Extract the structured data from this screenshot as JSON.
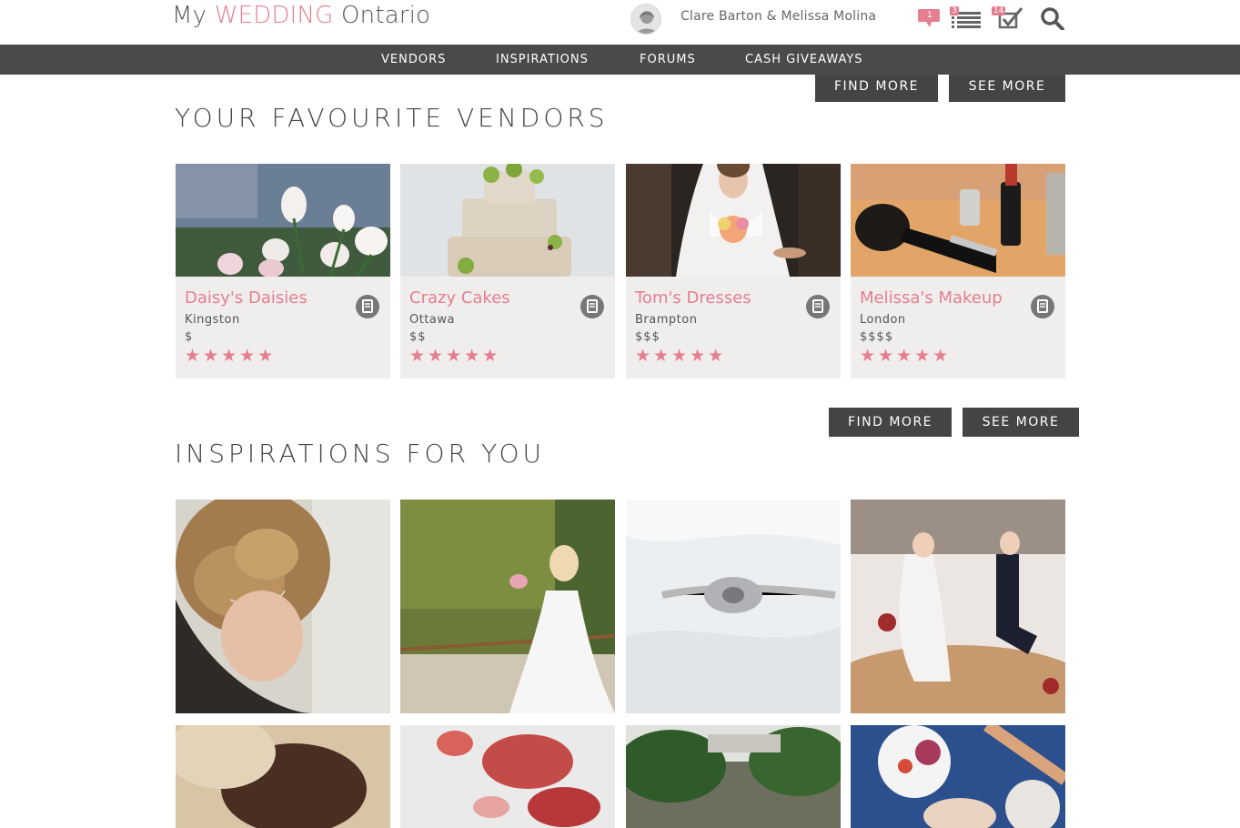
{
  "header": {
    "logo": {
      "prefix": "My ",
      "accent": "WEDDING",
      "suffix": " Ontario"
    },
    "user_names": "Clare Barton & Melissa Molina",
    "messages_badge": "1",
    "list_badge": "3",
    "checklist_badge": "14",
    "icons": [
      "chat-icon",
      "list-icon",
      "checklist-icon",
      "search-icon"
    ],
    "accent_color": "#e57e8f"
  },
  "nav": {
    "items": [
      "VENDORS",
      "INSPIRATIONS",
      "FORUMS",
      "CASH GIVEAWAYS"
    ]
  },
  "top_buttons": {
    "find_more": "FIND MORE",
    "see_more": "SEE MORE"
  },
  "vendors_section": {
    "title": "YOUR FAVOURITE VENDORS",
    "cards": [
      {
        "name": "Daisy's Daisies",
        "city": "Kingston",
        "price": "$",
        "stars": "★★★★★",
        "rating": 5
      },
      {
        "name": "Crazy Cakes",
        "city": "Ottawa",
        "price": "$$",
        "stars": "★★★★★",
        "rating": 5
      },
      {
        "name": "Tom's Dresses",
        "city": "Brampton",
        "price": "$$$",
        "stars": "★★★★★",
        "rating": 5
      },
      {
        "name": "Melissa's Makeup",
        "city": "London",
        "price": "$$$$",
        "stars": "★★★★★",
        "rating": 5
      }
    ],
    "find_more": "FIND MORE",
    "see_more": "SEE MORE"
  },
  "inspirations_section": {
    "title": "INSPIRATIONS FOR YOU"
  }
}
